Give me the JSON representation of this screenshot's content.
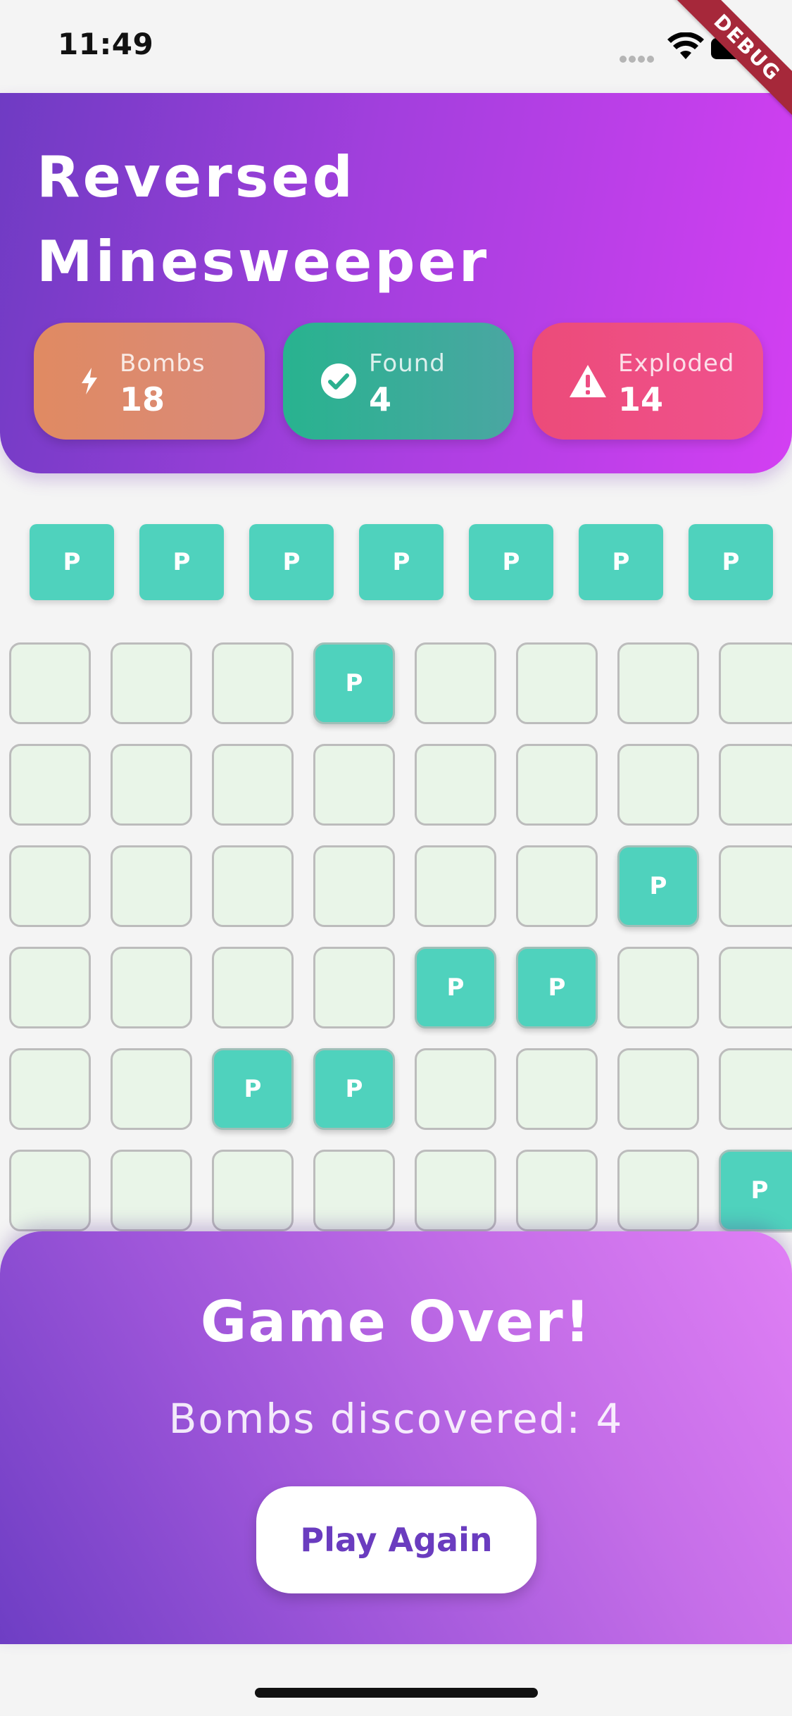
{
  "status_bar": {
    "time": "11:49"
  },
  "debug_banner": "DEBUG",
  "header": {
    "title": "Reversed Minesweeper",
    "stats": [
      {
        "label": "Bombs",
        "value": "18",
        "icon": "lightning-icon",
        "color": "#e08a62"
      },
      {
        "label": "Found",
        "value": "4",
        "icon": "check-circle-icon",
        "color": "#28b38f"
      },
      {
        "label": "Exploded",
        "value": "14",
        "icon": "warning-icon",
        "color": "#ec4b79"
      }
    ]
  },
  "placed_row": {
    "tile_label": "P",
    "count": 7
  },
  "grid": {
    "tile_label": "P",
    "rows": [
      [
        0,
        0,
        0,
        1,
        0,
        0,
        0,
        0
      ],
      [
        0,
        0,
        0,
        0,
        0,
        0,
        0,
        0
      ],
      [
        0,
        0,
        0,
        0,
        0,
        0,
        1,
        0
      ],
      [
        0,
        0,
        0,
        0,
        1,
        1,
        0,
        0
      ],
      [
        0,
        0,
        1,
        1,
        0,
        0,
        0,
        0
      ],
      [
        0,
        0,
        0,
        0,
        0,
        0,
        0,
        1
      ]
    ]
  },
  "game_over": {
    "title": "Game Over!",
    "subtitle": "Bombs discovered: 4",
    "button_label": "Play Again"
  },
  "colors": {
    "tile": "#4fd2bd",
    "cell": "#e9f5e8",
    "accent": "#6a3cbf"
  }
}
